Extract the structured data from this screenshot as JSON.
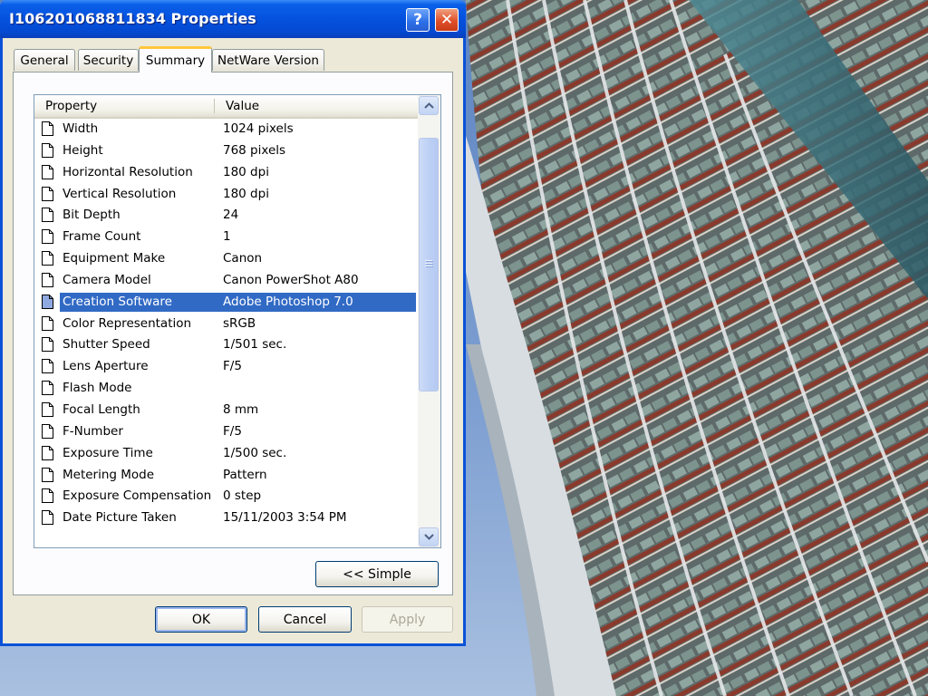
{
  "window": {
    "title": "I106201068811834 Properties",
    "help_label": "?",
    "close_label": "✕"
  },
  "tabs": [
    {
      "label": "General"
    },
    {
      "label": "Security"
    },
    {
      "label": "Summary",
      "active": true
    },
    {
      "label": "NetWare Version"
    }
  ],
  "list": {
    "columns": [
      "Property",
      "Value"
    ],
    "rows": [
      {
        "property": "Width",
        "value": "1024 pixels"
      },
      {
        "property": "Height",
        "value": "768 pixels"
      },
      {
        "property": "Horizontal Resolution",
        "value": "180 dpi"
      },
      {
        "property": "Vertical Resolution",
        "value": "180 dpi"
      },
      {
        "property": "Bit Depth",
        "value": "24"
      },
      {
        "property": "Frame Count",
        "value": "1"
      },
      {
        "property": "Equipment Make",
        "value": "Canon"
      },
      {
        "property": "Camera Model",
        "value": "Canon PowerShot A80"
      },
      {
        "property": "Creation Software",
        "value": "Adobe Photoshop 7.0",
        "selected": true
      },
      {
        "property": "Color Representation",
        "value": "sRGB"
      },
      {
        "property": "Shutter Speed",
        "value": "1/501 sec."
      },
      {
        "property": "Lens Aperture",
        "value": "F/5"
      },
      {
        "property": "Flash Mode",
        "value": ""
      },
      {
        "property": "Focal Length",
        "value": "8 mm"
      },
      {
        "property": "F-Number",
        "value": "F/5"
      },
      {
        "property": "Exposure Time",
        "value": "1/500 sec."
      },
      {
        "property": "Metering Mode",
        "value": "Pattern"
      },
      {
        "property": "Exposure Compensation",
        "value": "0 step"
      },
      {
        "property": "Date Picture Taken",
        "value": "15/11/2003 3:54 PM"
      }
    ]
  },
  "buttons": {
    "simple": "<< Simple",
    "ok": "OK",
    "cancel": "Cancel",
    "apply": "Apply"
  },
  "colors": {
    "titlebar": "#0553e0",
    "selection": "#316ac5",
    "dialog_face": "#ece9d8",
    "tab_highlight": "#ffc83c"
  }
}
